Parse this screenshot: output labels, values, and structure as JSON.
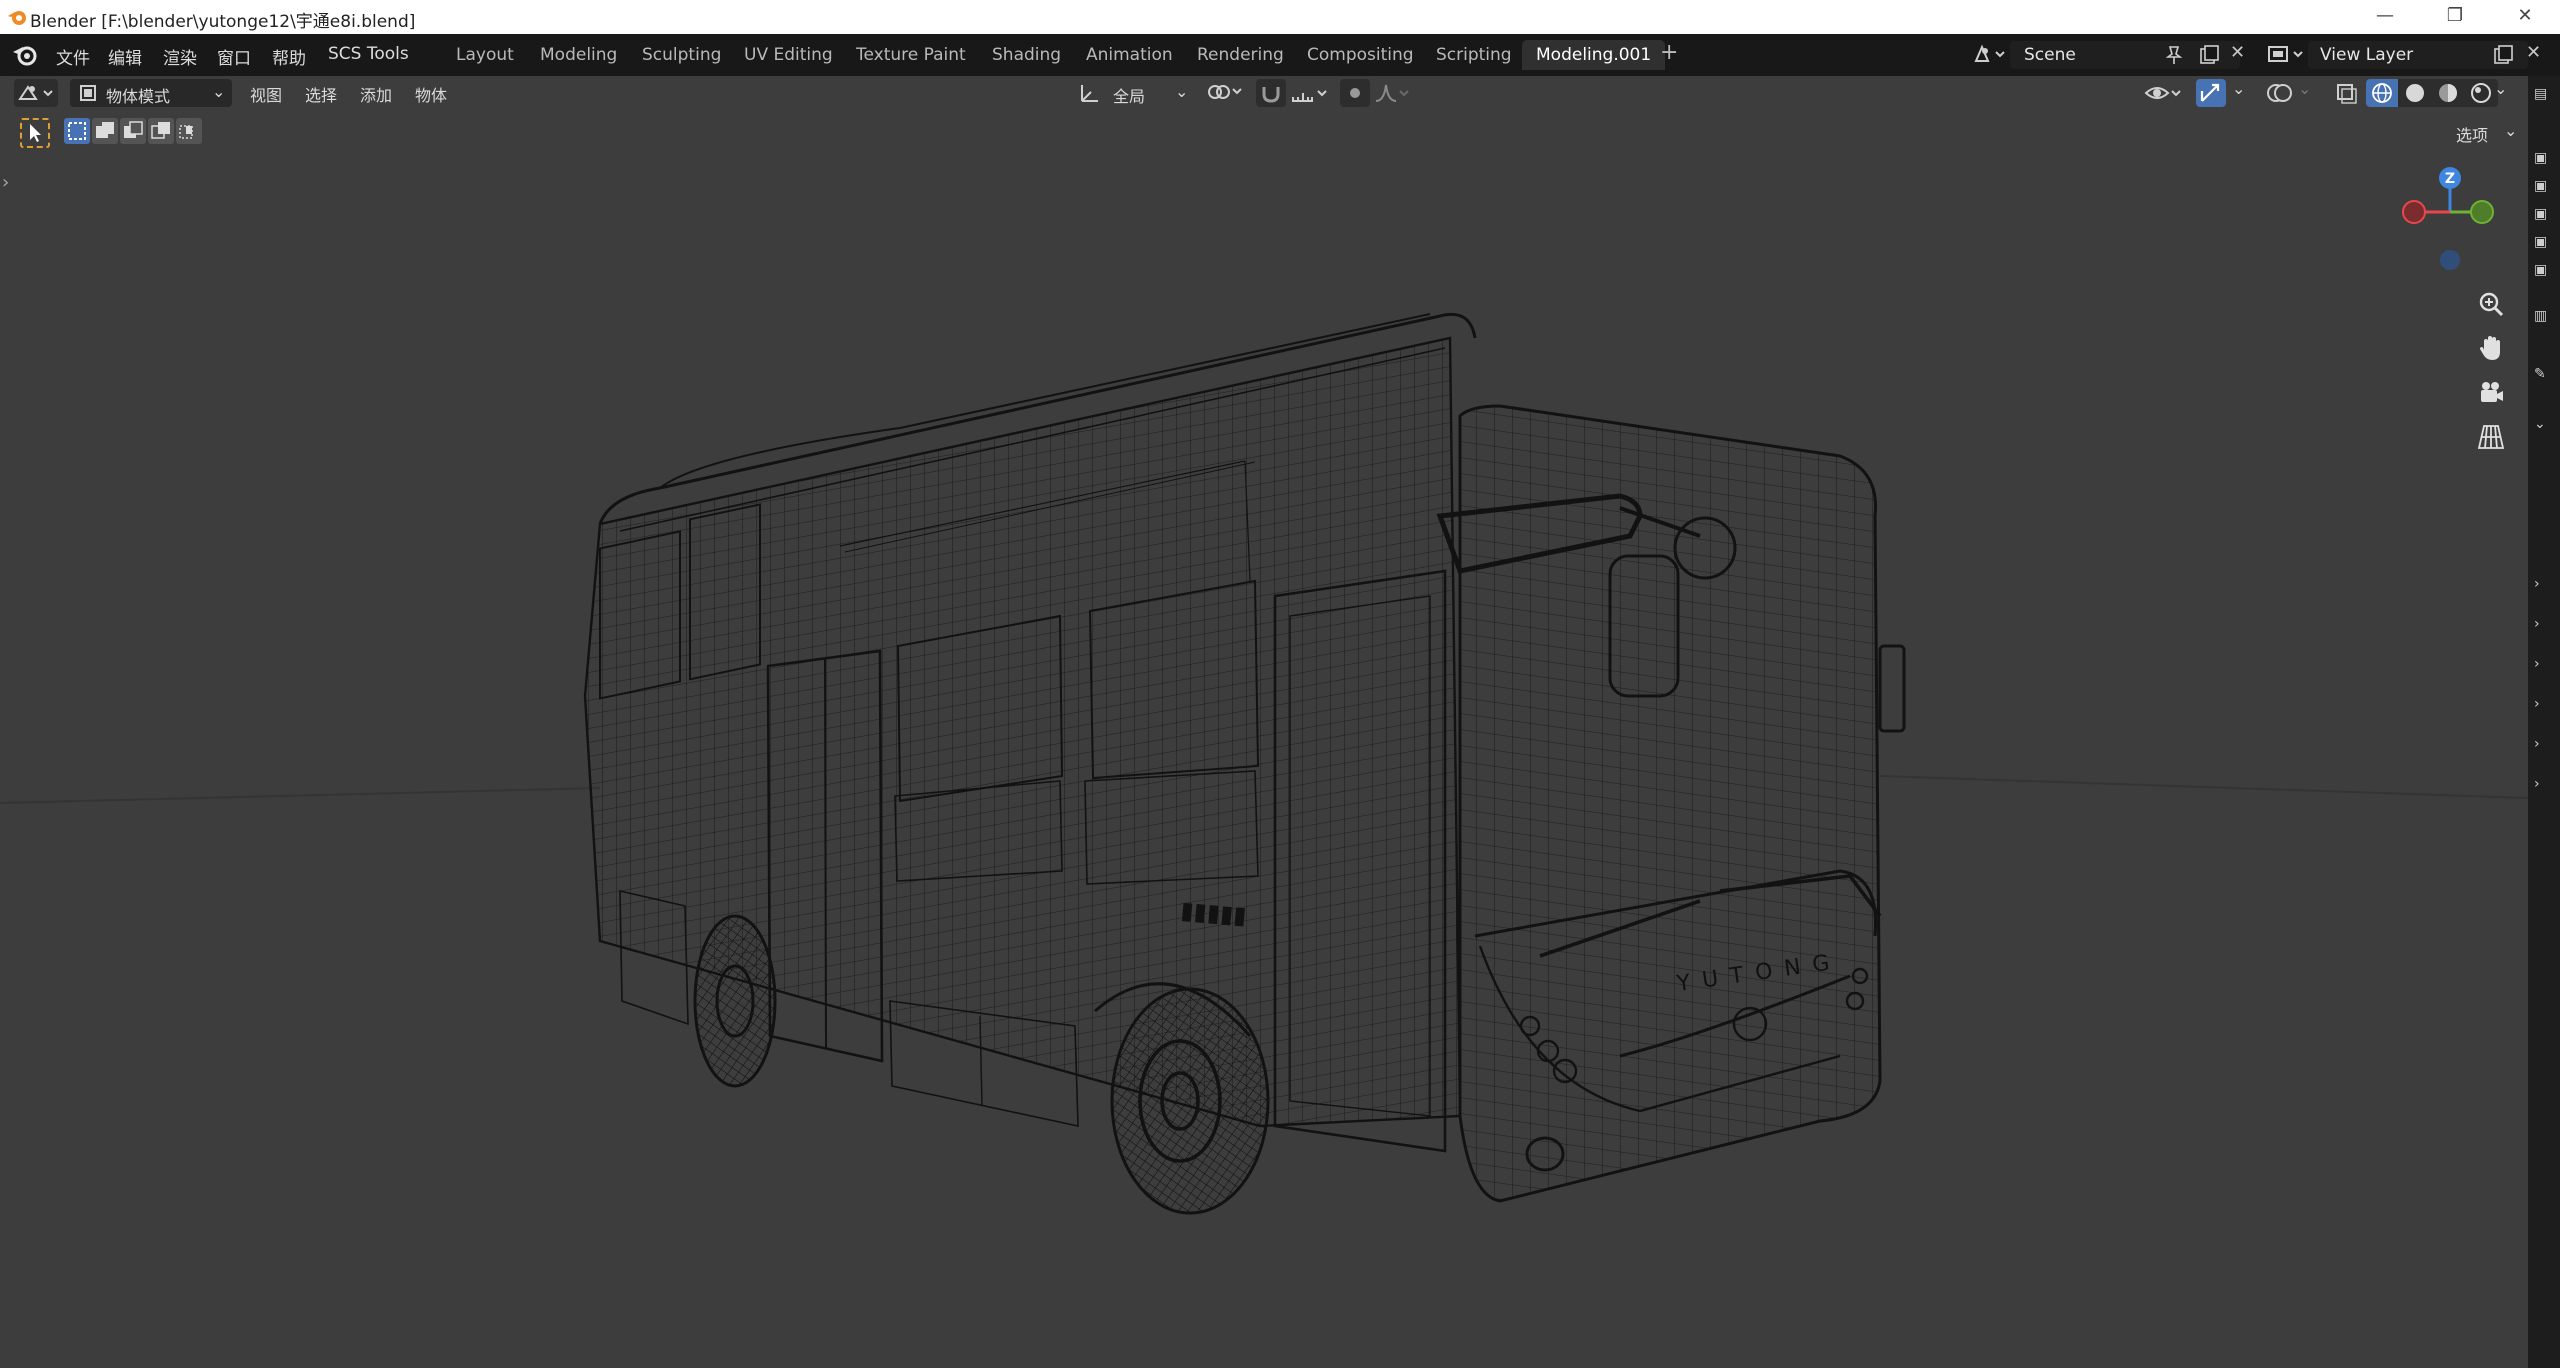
{
  "window": {
    "title": "Blender [F:\\blender\\yutonge12\\宇通e8i.blend]",
    "minimize": "—",
    "maximize": "❐",
    "close": "✕"
  },
  "topbar": {
    "menus": [
      "文件",
      "编辑",
      "渲染",
      "窗口",
      "帮助",
      "SCS Tools"
    ],
    "workspaces": [
      "Layout",
      "Modeling",
      "Sculpting",
      "UV Editing",
      "Texture Paint",
      "Shading",
      "Animation",
      "Rendering",
      "Compositing",
      "Scripting",
      "Modeling.001"
    ],
    "active_workspace": "Modeling.001",
    "add_workspace": "+",
    "scene_label": "Scene",
    "view_layer_label": "View Layer"
  },
  "viewport_header": {
    "mode": "物体模式",
    "menus": [
      "视图",
      "选择",
      "添加",
      "物体"
    ],
    "transform_orientation": "全局",
    "options_label": "选项"
  },
  "gizmo": {
    "z_label": "Z"
  },
  "model": {
    "brand_text": "YUTONG"
  },
  "colors": {
    "accent": "#4772b3",
    "viewport_bg": "#3d3d3d",
    "wire": "#111111",
    "axis_x": "#e8474d",
    "axis_y": "#6fb333",
    "axis_z": "#3f86e0"
  }
}
